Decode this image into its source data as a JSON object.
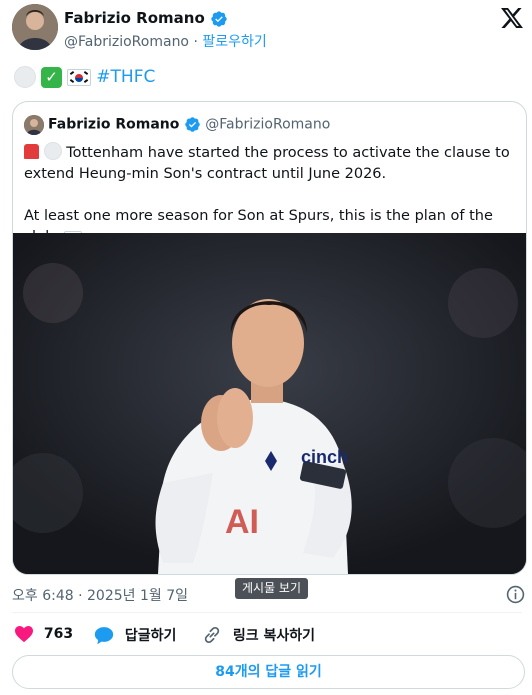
{
  "author": {
    "name": "Fabrizio Romano",
    "handle": "@FabrizioRomano",
    "separator": "·",
    "follow_label": "팔로우하기"
  },
  "tweet": {
    "emoji_icons": [
      "white-circle-icon",
      "check-mark-icon",
      "korea-flag-icon"
    ],
    "hashtag": "#THFC"
  },
  "quote": {
    "author_name": "Fabrizio Romano",
    "author_handle": "@FabrizioRomano",
    "emoji_icons": [
      "rotating-light-icon",
      "white-circle-icon"
    ],
    "line1": "Tottenham have started the process to activate the clause to",
    "line2": "extend Heung-min Son's contract until June 2026.",
    "line3": "At least one more season for Son at Spurs, this is the plan of the club.",
    "trailing_icon": "korea-flag-icon",
    "image_description_icons": [
      "player-photo"
    ]
  },
  "meta": {
    "timestamp": "오후 6:48 · 2025년 1월 7일",
    "tooltip": "게시물 보기"
  },
  "actions": {
    "likes": "763",
    "reply_label": "답글하기",
    "copy_link_label": "링크 복사하기"
  },
  "footer": {
    "read_replies": "84개의 답글 읽기"
  },
  "colors": {
    "accent": "#1d9bf0",
    "like": "#f91880",
    "muted": "#536471",
    "border": "#cfd9de"
  }
}
